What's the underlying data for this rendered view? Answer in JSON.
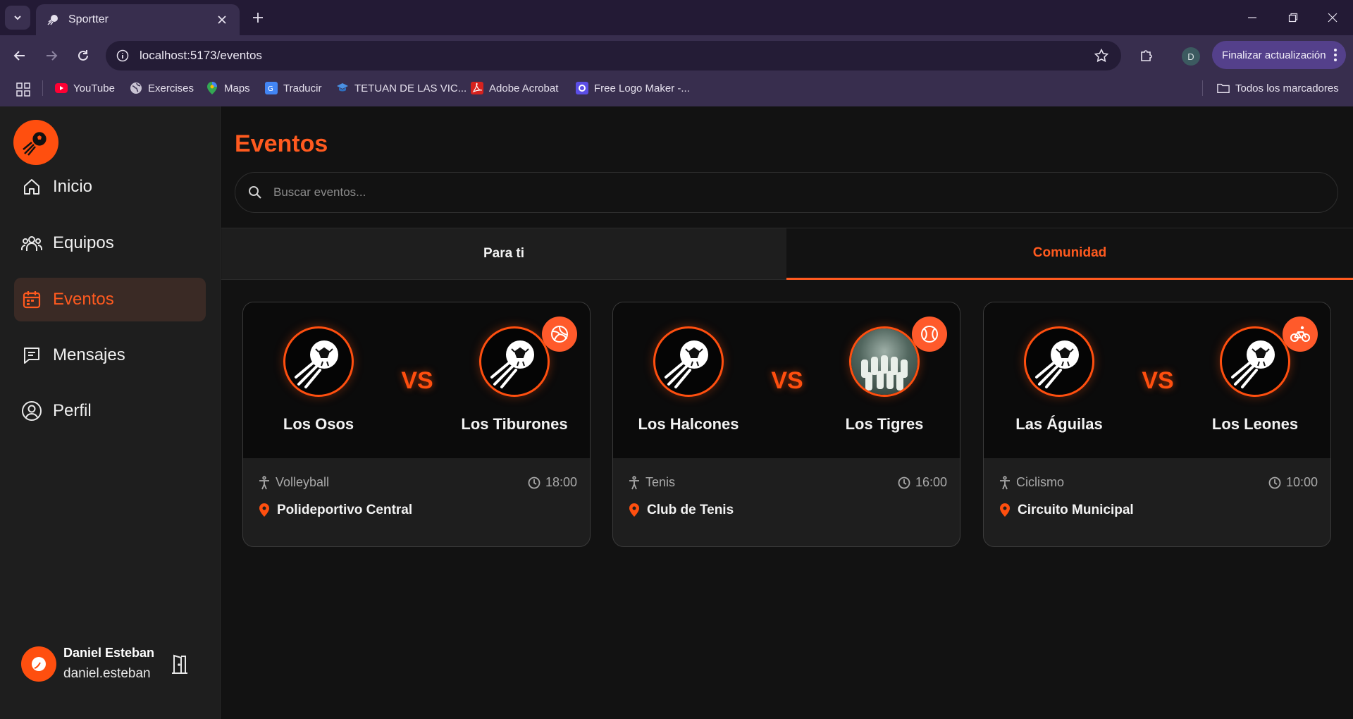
{
  "browser": {
    "tab_title": "Sportter",
    "url": "localhost:5173/eventos",
    "update_label": "Finalizar actualización",
    "profile_initial": "D",
    "bookmarks": [
      "YouTube",
      "Exercises",
      "Maps",
      "Traducir",
      "TETUAN DE LAS VIC...",
      "Adobe Acrobat",
      "Free Logo Maker -..."
    ],
    "all_bookmarks_label": "Todos los marcadores"
  },
  "sidebar": {
    "items": [
      {
        "label": "Inicio",
        "icon": "home-icon"
      },
      {
        "label": "Equipos",
        "icon": "users-icon"
      },
      {
        "label": "Eventos",
        "icon": "calendar-icon",
        "active": true
      },
      {
        "label": "Mensajes",
        "icon": "message-icon"
      },
      {
        "label": "Perfil",
        "icon": "user-circle-icon"
      }
    ],
    "user": {
      "name": "Daniel Esteban",
      "email": "daniel.esteban"
    }
  },
  "main": {
    "title": "Eventos",
    "search_placeholder": "Buscar eventos...",
    "tabs": [
      {
        "label": "Para ti"
      },
      {
        "label": "Comunidad",
        "active": true
      }
    ],
    "events": [
      {
        "home": "Los Osos",
        "away": "Los Tiburones",
        "vs": "VS",
        "sport": "Volleyball",
        "sport_icon": "volleyball-icon",
        "time": "18:00",
        "location": "Polideportivo Central"
      },
      {
        "home": "Los Halcones",
        "away": "Los Tigres",
        "vs": "VS",
        "sport": "Tenis",
        "sport_icon": "tennis-ball-icon",
        "time": "16:00",
        "location": "Club de Tenis"
      },
      {
        "home": "Las Águilas",
        "away": "Los Leones",
        "vs": "VS",
        "sport": "Ciclismo",
        "sport_icon": "bicycle-icon",
        "time": "10:00",
        "location": "Circuito Municipal"
      }
    ]
  },
  "colors": {
    "accent": "#ff5a1f",
    "sidebar_bg": "#1e1e1e",
    "page_bg": "#121212",
    "chrome": "#382e4e"
  }
}
